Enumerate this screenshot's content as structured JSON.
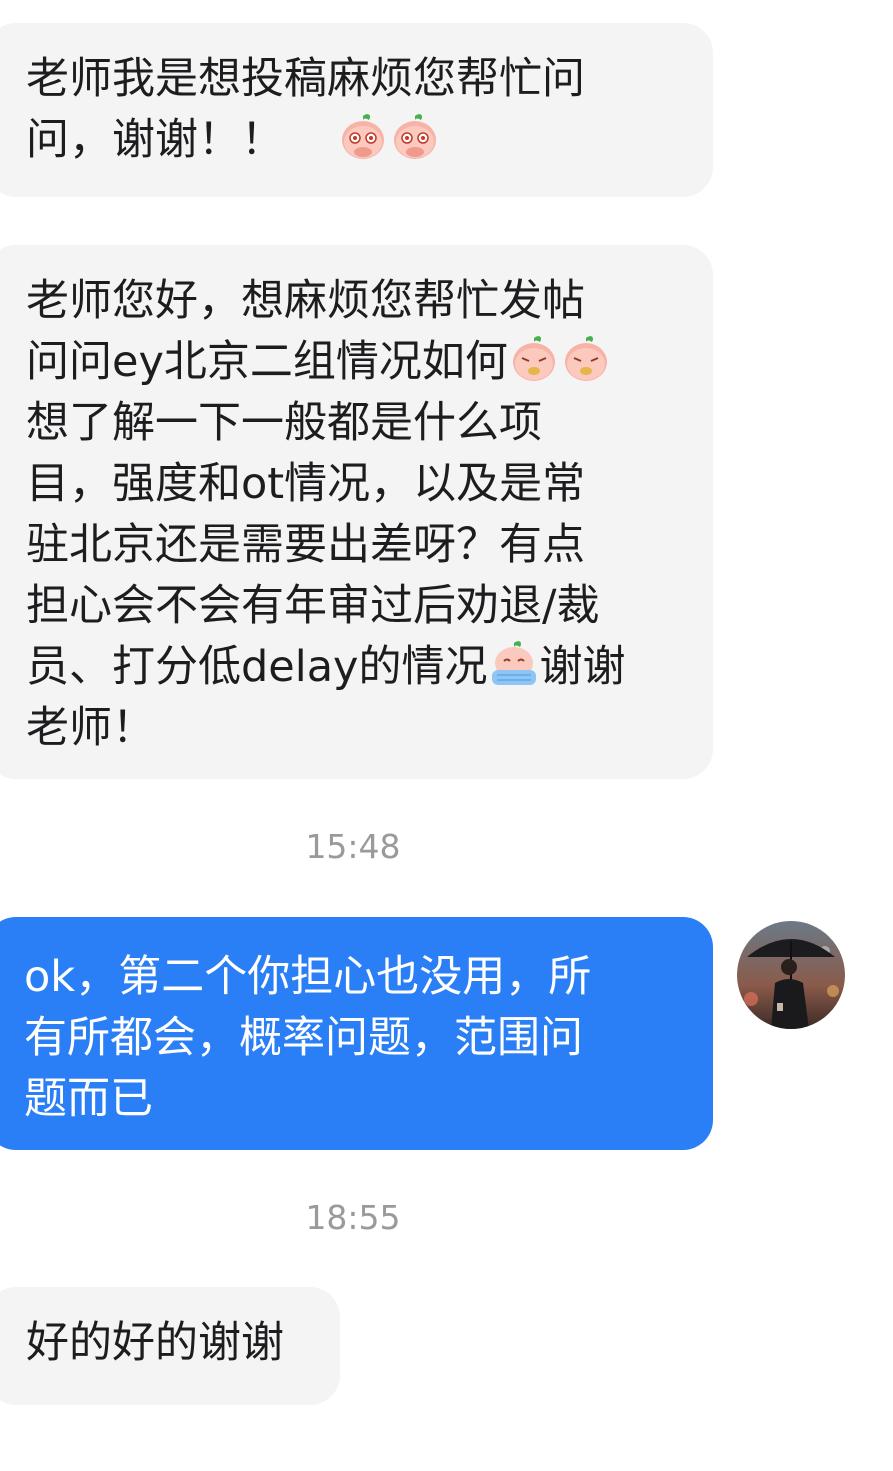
{
  "messages": {
    "m1": {
      "line1": "老师我是想投稿麻烦您帮忙问",
      "line2": "问，谢谢！！"
    },
    "m2": {
      "line1": "老师您好，想麻烦您帮忙发帖",
      "line2": "问问ey北京二组情况如何",
      "line3": "想了解一下一般都是什么项",
      "line4": "目，强度和ot情况，以及是常",
      "line5": "驻北京还是需要出差呀？有点",
      "line6": "担心会不会有年审过后劝退/裁",
      "line7a": "员、打分低delay的情况",
      "line7b": "谢谢",
      "line8": "老师！"
    },
    "time1": "15:48",
    "m3": {
      "line1": "ok，第二个你担心也没用，所",
      "line2": "有所都会，概率问题，范围问",
      "line3": "题而已"
    },
    "time2": "18:55",
    "m4": {
      "line1": "好的好的谢谢"
    }
  },
  "stickers": [
    "peach-pleading-sticker",
    "peach-pleading-sticker",
    "peach-embarrassed-sticker",
    "peach-embarrassed-sticker",
    "peach-crying-sticker"
  ],
  "avatar": "man-with-umbrella-avatar",
  "colors": {
    "incoming_bubble": "#f4f4f5",
    "outgoing_bubble": "#2b7ff6",
    "timestamp": "#9a9a9a",
    "text_dark": "#1d1d1f",
    "text_light": "#ffffff"
  }
}
